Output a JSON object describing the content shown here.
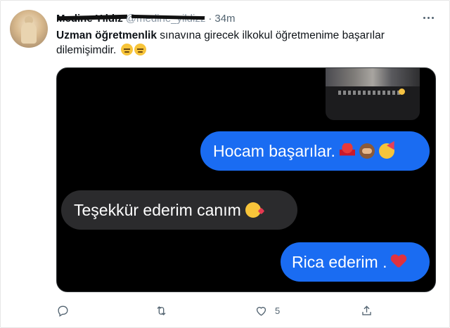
{
  "tweet": {
    "author_name": "Medine Yıldız",
    "author_handle": "@medine_yildizz",
    "separator": "·",
    "time": "34m",
    "text_bold": "Uzman öğretmenlik",
    "text_rest": " sınavına girecek ilkokul öğretmenime başarılar dilemişimdir."
  },
  "media": {
    "messages": [
      {
        "direction": "outgoing",
        "text": "Hocam başarılar.",
        "emojis": [
          "dancer-emoji",
          "see-no-evil-monkey-emoji",
          "partying-face-emoji"
        ]
      },
      {
        "direction": "incoming",
        "text": "Teşekkür ederim canım",
        "emojis": [
          "face-blowing-kiss-emoji"
        ]
      },
      {
        "direction": "outgoing",
        "text": "Rica ederim .",
        "emojis": [
          "red-heart-emoji"
        ]
      }
    ]
  },
  "actions": {
    "reply_icon": "reply-icon",
    "retweet_icon": "retweet-icon",
    "like_icon": "heart-icon",
    "like_count": "5",
    "share_icon": "share-icon"
  },
  "colors": {
    "outgoing_bubble": "#1a6cf2",
    "incoming_bubble": "#2b2b2d",
    "secondary_text": "#536471"
  }
}
